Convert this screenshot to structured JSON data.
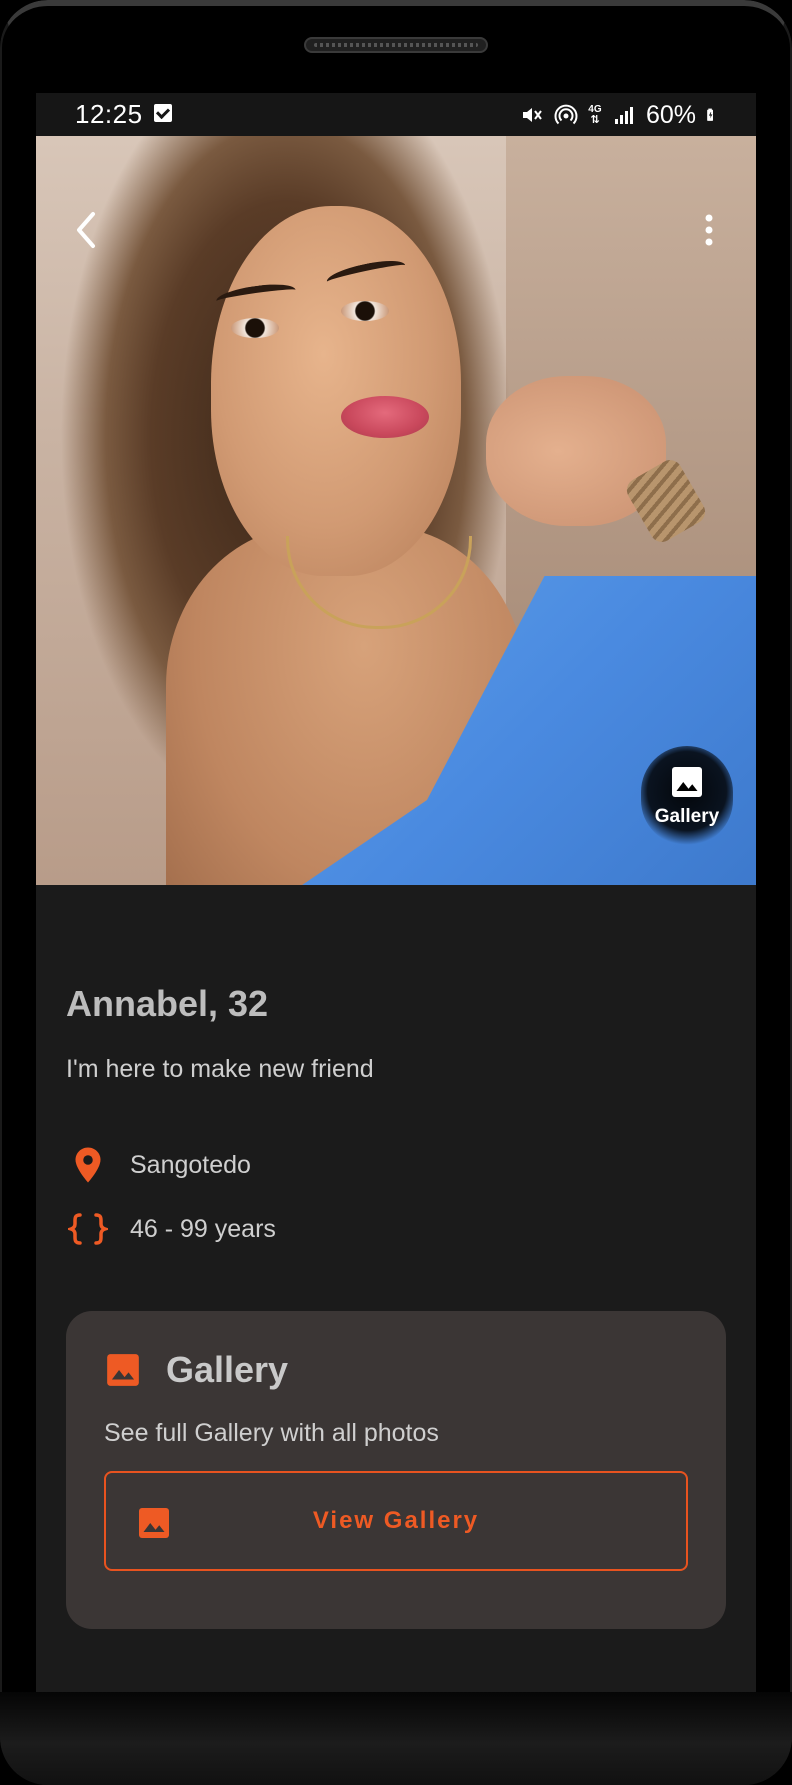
{
  "status_bar": {
    "time": "12:25",
    "network_type": "4G",
    "battery_percent": "60%"
  },
  "hero": {
    "gallery_fab_label": "Gallery"
  },
  "profile": {
    "name_age": "Annabel, 32",
    "bio": "I'm here to make new friend",
    "location": "Sangotedo",
    "age_range": "46 - 99 years"
  },
  "gallery_card": {
    "title": "Gallery",
    "subtitle": "See full Gallery with all photos",
    "button_label": "View Gallery"
  },
  "colors": {
    "accent": "#ee5a24",
    "background": "#1b1b1b",
    "card": "#3b3635"
  },
  "icons": {
    "back": "chevron-left-icon",
    "menu": "more-vert-icon",
    "gallery": "image-icon",
    "location": "location-pin-icon",
    "age": "braces-icon"
  }
}
